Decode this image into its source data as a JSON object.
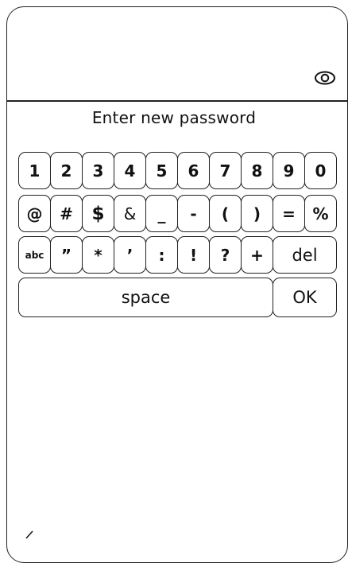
{
  "prompt": "Enter new password",
  "icons": {
    "visibility_toggle": "eye-icon"
  },
  "keyboard": {
    "row1": [
      "1",
      "2",
      "3",
      "4",
      "5",
      "6",
      "7",
      "8",
      "9",
      "0"
    ],
    "row2": [
      "@",
      "#",
      "$",
      "&",
      "_",
      "-",
      "(",
      ")",
      "=",
      "%"
    ],
    "row3": [
      "abc",
      "”",
      "*",
      "’",
      ":",
      "!",
      "?",
      "+"
    ],
    "del": "del",
    "space": "space",
    "ok": "OK"
  }
}
